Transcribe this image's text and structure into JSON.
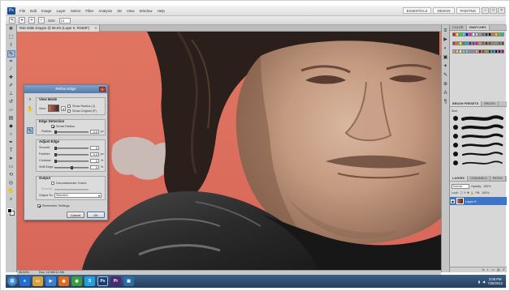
{
  "app": {
    "logo": "Ps",
    "menu": [
      "File",
      "Edit",
      "Image",
      "Layer",
      "Select",
      "Filter",
      "Analysis",
      "3D",
      "View",
      "Window",
      "Help"
    ],
    "workspace_buttons": [
      "ESSENTIALS",
      "DESIGN",
      "PAINTING"
    ],
    "window_controls": [
      "–",
      "□",
      "×"
    ]
  },
  "options_bar": {
    "size_label": "Size:",
    "size_value": "13"
  },
  "document": {
    "tab_title": "Rob Wide Dragon @ 96.6% (Layer 0, RGB/8*)",
    "tab_close": "×",
    "zoom": "96.63%",
    "doc_info": "Doc: 12.9M/12.9M"
  },
  "dialog": {
    "title": "Refine Edge",
    "close": "×",
    "view_mode": {
      "title": "View Mode",
      "view_label": "View:",
      "show_radius": "Show Radius (J)",
      "show_original": "Show Original (P)"
    },
    "edge_detection": {
      "title": "Edge Detection",
      "smart_radius": "Smart Radius",
      "radius_label": "Radius:",
      "radius_value": "0.0",
      "radius_unit": "px"
    },
    "adjust_edge": {
      "title": "Adjust Edge",
      "smooth_label": "Smooth:",
      "smooth_value": "0",
      "feather_label": "Feather:",
      "feather_value": "0.0",
      "feather_unit": "px",
      "contrast_label": "Contrast:",
      "contrast_value": "0",
      "contrast_unit": "%",
      "shift_label": "Shift Edge:",
      "shift_value": "0",
      "shift_unit": "%"
    },
    "output": {
      "title": "Output",
      "decontaminate": "Decontaminate Colors",
      "amount_label": "Amount:",
      "output_to_label": "Output To:",
      "output_to_value": "Selection"
    },
    "remember": "Remember Settings",
    "cancel": "Cancel",
    "ok": "OK"
  },
  "panels": {
    "swatches_tabs": [
      "COLOR",
      "SWATCHES"
    ],
    "swatch_colors": [
      "#ff0000",
      "#ffff00",
      "#00ff00",
      "#00ffff",
      "#0000ff",
      "#ff00ff",
      "#ffffff",
      "#cccccc",
      "#999999",
      "#666666",
      "#333333",
      "#000000",
      "#ff6600",
      "#ffcc00",
      "#66cc00",
      "#00cc99",
      "#ed1c24",
      "#f26522",
      "#fff200",
      "#00a651",
      "#00aeef",
      "#2e3192",
      "#92278f",
      "#ec008c",
      "#c69c6d",
      "#8c6239",
      "#603913",
      "#754c24",
      "#a67c52",
      "#998675",
      "#736357",
      "#534741",
      "#f7977a",
      "#fdc68a",
      "#fff799",
      "#82ca9c",
      "#6dcff6",
      "#8393ca",
      "#a186be",
      "#f49ac1",
      "#9e0b0f",
      "#a0410d",
      "#aba000",
      "#005e20",
      "#0072bc",
      "#1b1464",
      "#440e62",
      "#9e005d"
    ],
    "brushes_tabs": [
      "BRUSH PRESETS",
      "BRUSH"
    ],
    "brush_size_label": "Size:",
    "layers_tabs": [
      "LAYERS",
      "CHANNELS",
      "PATHS"
    ],
    "blend_mode": "Normal",
    "opacity_label": "Opacity:",
    "opacity_value": "100%",
    "lock_label": "Lock:",
    "fill_label": "Fill:",
    "fill_value": "100%",
    "layer_name": "Layer 0",
    "footer_icons": [
      "fx",
      "◐",
      "▭",
      "▤",
      "✕"
    ]
  },
  "taskbar": {
    "apps": [
      {
        "name": "ie",
        "label": "e",
        "color": "#1f6fd1"
      },
      {
        "name": "explorer",
        "label": "▭",
        "color": "#d5a43a"
      },
      {
        "name": "media",
        "label": "▶",
        "color": "#3a7fd1"
      },
      {
        "name": "firefox",
        "label": "◉",
        "color": "#e06b1f"
      },
      {
        "name": "chrome",
        "label": "◍",
        "color": "#3c9b3c"
      },
      {
        "name": "skype",
        "label": "S",
        "color": "#1fa0e0"
      },
      {
        "name": "photoshop",
        "label": "Ps",
        "color": "#1b3c73"
      },
      {
        "name": "premiere",
        "label": "Pr",
        "color": "#4a2a6e"
      },
      {
        "name": "app9",
        "label": "▣",
        "color": "#2b6ca8"
      }
    ],
    "time": "3:08 PM",
    "date": "7/28/2012"
  }
}
